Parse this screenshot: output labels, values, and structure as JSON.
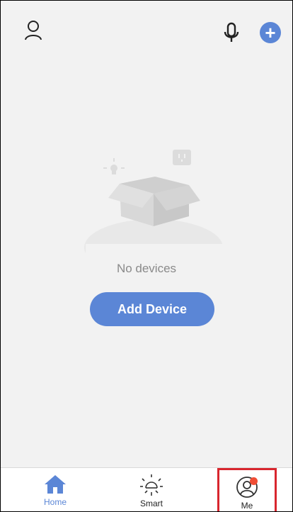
{
  "header": {
    "user_icon": "user-outline-icon",
    "mic_icon": "microphone-icon",
    "add_icon": "plus-circle-icon",
    "add_symbol": "+"
  },
  "main": {
    "empty_message": "No devices",
    "add_device_label": "Add Device"
  },
  "tabbar": {
    "tabs": [
      {
        "label": "Home",
        "icon": "home-icon",
        "active": true
      },
      {
        "label": "Smart",
        "icon": "sun-icon",
        "active": false
      },
      {
        "label": "Me",
        "icon": "profile-icon",
        "active": false,
        "badge": true
      }
    ]
  },
  "colors": {
    "accent": "#5b86d6",
    "background": "#f2f2f2",
    "badge": "#f04d35",
    "highlight_box": "#d8262e"
  }
}
